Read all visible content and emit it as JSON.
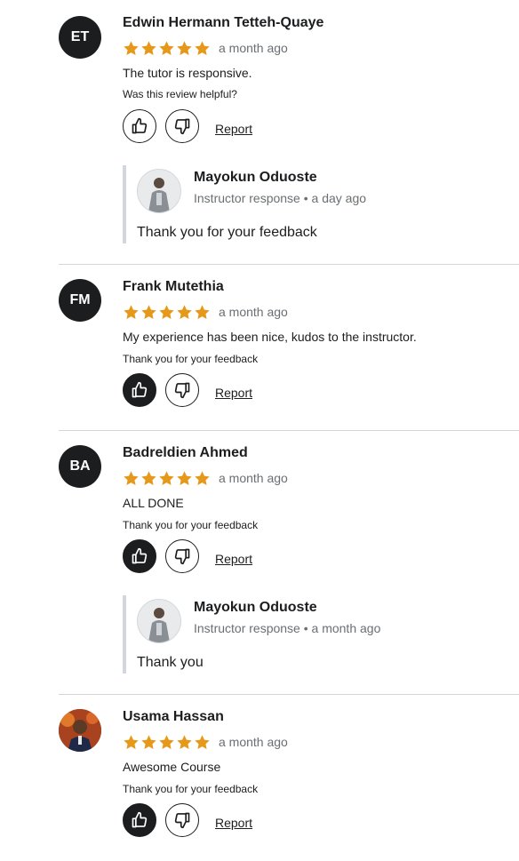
{
  "reviews": [
    {
      "initials": "ET",
      "name": "Edwin Hermann Tetteh-Quaye",
      "rating": 5,
      "date": "a month ago",
      "text": "The tutor is responsive.",
      "helpful_text": "Was this review helpful?",
      "liked": false,
      "report_label": "Report",
      "response": {
        "name": "Mayokun Oduoste",
        "meta": "Instructor response • a day ago",
        "text": "Thank you for your feedback"
      }
    },
    {
      "initials": "FM",
      "name": "Frank Mutethia",
      "rating": 5,
      "date": "a month ago",
      "text": "My experience has been nice, kudos to the instructor.",
      "helpful_text": "Thank you for your feedback",
      "liked": true,
      "report_label": "Report"
    },
    {
      "initials": "BA",
      "name": "Badreldien Ahmed",
      "rating": 5,
      "date": "a month ago",
      "text": "ALL DONE",
      "helpful_text": "Thank you for your feedback",
      "liked": true,
      "report_label": "Report",
      "response": {
        "name": "Mayokun Oduoste",
        "meta": "Instructor response • a month ago",
        "text": "Thank you"
      }
    },
    {
      "initials": "",
      "name": "Usama Hassan",
      "rating": 5,
      "date": "a month ago",
      "text": "Awesome Course",
      "helpful_text": "Thank you for your feedback",
      "liked": true,
      "report_label": "Report"
    }
  ],
  "colors": {
    "star": "#e59819",
    "text": "#1c1d1f",
    "muted": "#6a6f73",
    "divider": "#d1d7dc"
  }
}
